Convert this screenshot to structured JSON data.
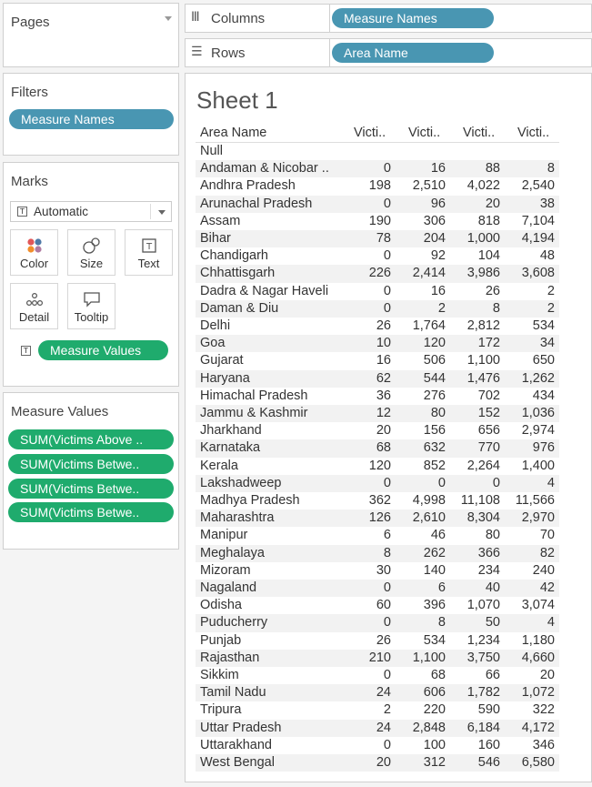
{
  "pages": {
    "title": "Pages"
  },
  "filters": {
    "title": "Filters",
    "pill": "Measure Names"
  },
  "marks": {
    "title": "Marks",
    "type": "Automatic",
    "buttons": [
      "Color",
      "Size",
      "Text",
      "Detail",
      "Tooltip"
    ],
    "pill": "Measure Values"
  },
  "measure_values": {
    "title": "Measure Values",
    "pills": [
      "SUM(Victims Above ..",
      "SUM(Victims Betwe..",
      "SUM(Victims Betwe..",
      "SUM(Victims Betwe.."
    ]
  },
  "columns": {
    "label": "Columns",
    "pill": "Measure Names"
  },
  "rows_shelf": {
    "label": "Rows",
    "pill": "Area Name"
  },
  "sheet": {
    "title": "Sheet 1",
    "headers": [
      "Area Name",
      "Victi..",
      "Victi..",
      "Victi..",
      "Victi.."
    ],
    "rows": [
      [
        "Null",
        "",
        "",
        "",
        ""
      ],
      [
        "Andaman & Nicobar ..",
        "0",
        "16",
        "88",
        "8"
      ],
      [
        "Andhra Pradesh",
        "198",
        "2,510",
        "4,022",
        "2,540"
      ],
      [
        "Arunachal Pradesh",
        "0",
        "96",
        "20",
        "38"
      ],
      [
        "Assam",
        "190",
        "306",
        "818",
        "7,104"
      ],
      [
        "Bihar",
        "78",
        "204",
        "1,000",
        "4,194"
      ],
      [
        "Chandigarh",
        "0",
        "92",
        "104",
        "48"
      ],
      [
        "Chhattisgarh",
        "226",
        "2,414",
        "3,986",
        "3,608"
      ],
      [
        "Dadra & Nagar Haveli",
        "0",
        "16",
        "26",
        "2"
      ],
      [
        "Daman & Diu",
        "0",
        "2",
        "8",
        "2"
      ],
      [
        "Delhi",
        "26",
        "1,764",
        "2,812",
        "534"
      ],
      [
        "Goa",
        "10",
        "120",
        "172",
        "34"
      ],
      [
        "Gujarat",
        "16",
        "506",
        "1,100",
        "650"
      ],
      [
        "Haryana",
        "62",
        "544",
        "1,476",
        "1,262"
      ],
      [
        "Himachal Pradesh",
        "36",
        "276",
        "702",
        "434"
      ],
      [
        "Jammu & Kashmir",
        "12",
        "80",
        "152",
        "1,036"
      ],
      [
        "Jharkhand",
        "20",
        "156",
        "656",
        "2,974"
      ],
      [
        "Karnataka",
        "68",
        "632",
        "770",
        "976"
      ],
      [
        "Kerala",
        "120",
        "852",
        "2,264",
        "1,400"
      ],
      [
        "Lakshadweep",
        "0",
        "0",
        "0",
        "4"
      ],
      [
        "Madhya Pradesh",
        "362",
        "4,998",
        "11,108",
        "11,566"
      ],
      [
        "Maharashtra",
        "126",
        "2,610",
        "8,304",
        "2,970"
      ],
      [
        "Manipur",
        "6",
        "46",
        "80",
        "70"
      ],
      [
        "Meghalaya",
        "8",
        "262",
        "366",
        "82"
      ],
      [
        "Mizoram",
        "30",
        "140",
        "234",
        "240"
      ],
      [
        "Nagaland",
        "0",
        "6",
        "40",
        "42"
      ],
      [
        "Odisha",
        "60",
        "396",
        "1,070",
        "3,074"
      ],
      [
        "Puducherry",
        "0",
        "8",
        "50",
        "4"
      ],
      [
        "Punjab",
        "26",
        "534",
        "1,234",
        "1,180"
      ],
      [
        "Rajasthan",
        "210",
        "1,100",
        "3,750",
        "4,660"
      ],
      [
        "Sikkim",
        "0",
        "68",
        "66",
        "20"
      ],
      [
        "Tamil Nadu",
        "24",
        "606",
        "1,782",
        "1,072"
      ],
      [
        "Tripura",
        "2",
        "220",
        "590",
        "322"
      ],
      [
        "Uttar Pradesh",
        "24",
        "2,848",
        "6,184",
        "4,172"
      ],
      [
        "Uttarakhand",
        "0",
        "100",
        "160",
        "346"
      ],
      [
        "West Bengal",
        "20",
        "312",
        "546",
        "6,580"
      ]
    ]
  },
  "colors": {
    "pill_blue": "#4996b2",
    "pill_green": "#1fab6d"
  }
}
